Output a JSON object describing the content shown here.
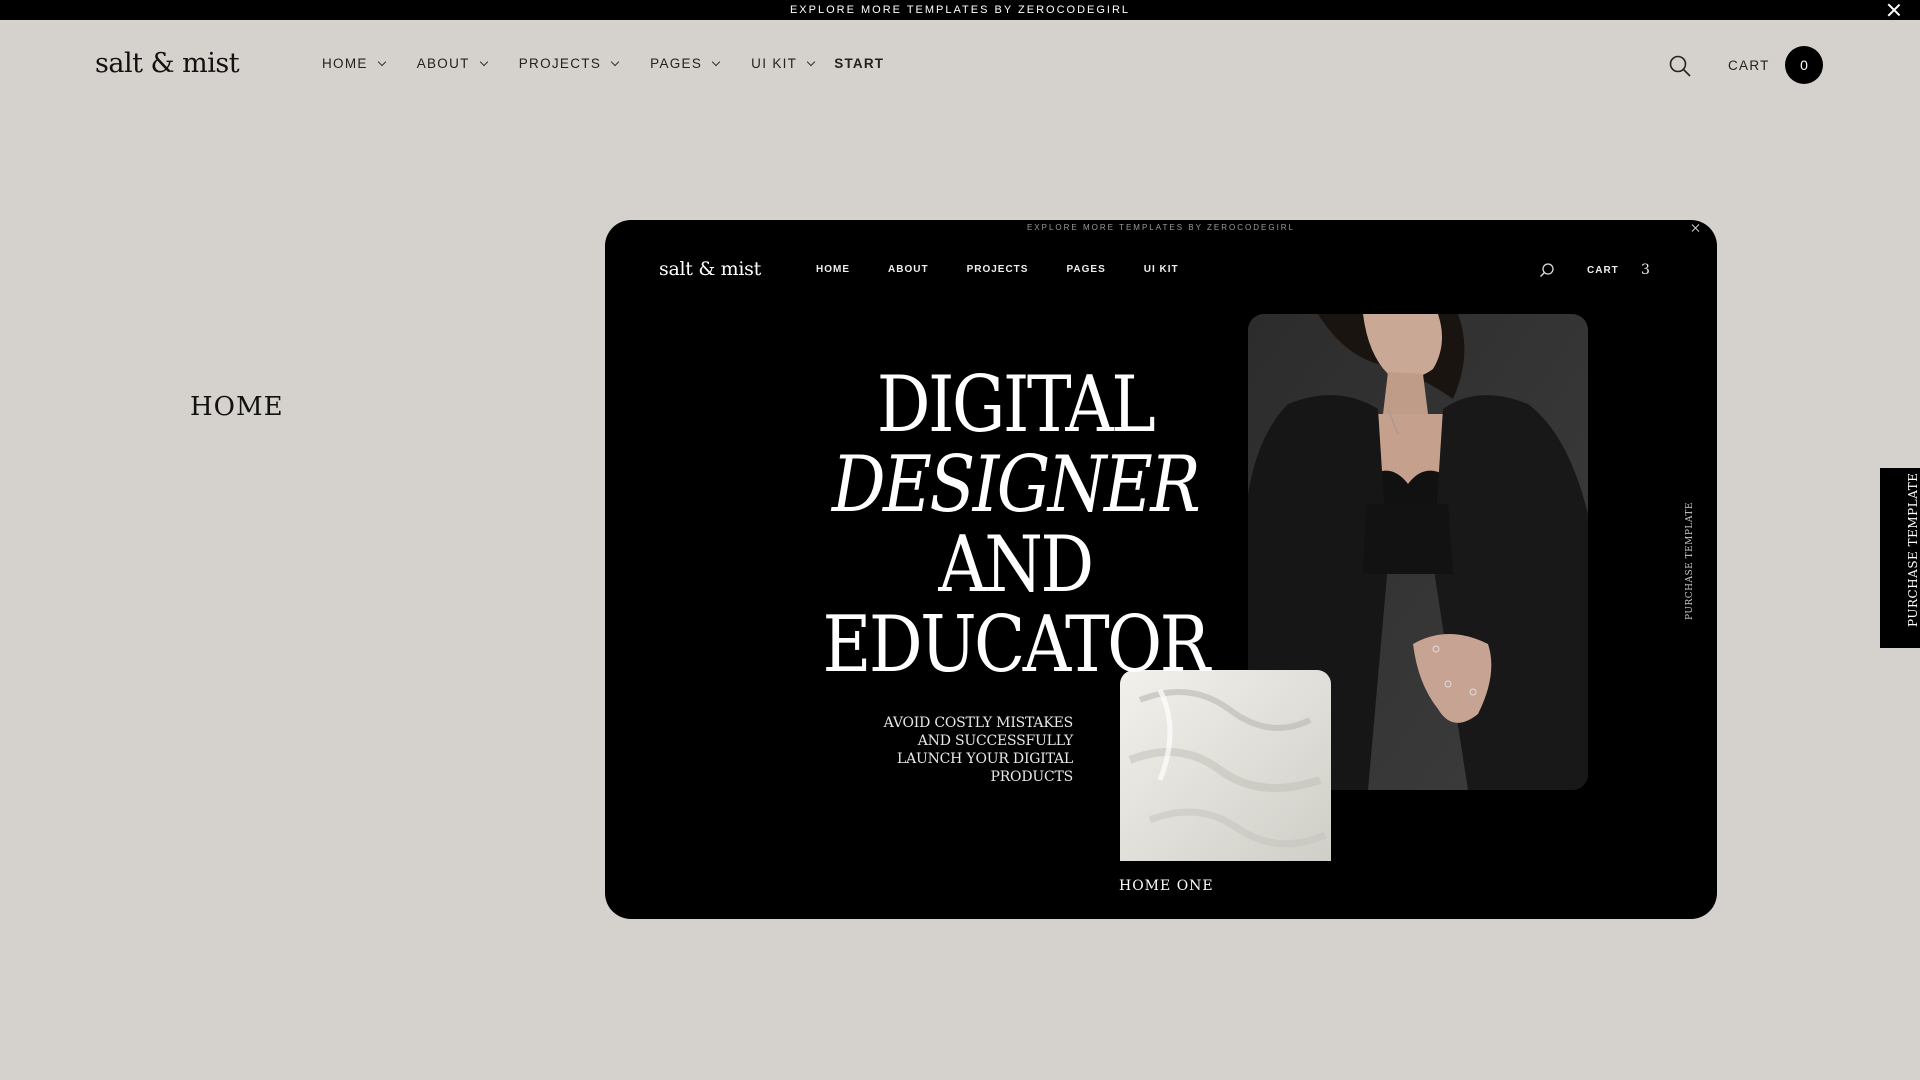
{
  "announcement": {
    "text": "EXPLORE MORE TEMPLATES BY ZEROCODEGIRL"
  },
  "header": {
    "logo": "salt & mist",
    "nav": [
      {
        "label": "HOME",
        "dropdown": true
      },
      {
        "label": "ABOUT",
        "dropdown": true
      },
      {
        "label": "PROJECTS",
        "dropdown": true
      },
      {
        "label": "PAGES",
        "dropdown": true
      },
      {
        "label": "UI KIT",
        "dropdown": true
      },
      {
        "label": "START",
        "dropdown": false
      }
    ],
    "cart_label": "CART",
    "cart_count": "0"
  },
  "section": {
    "title": "HOME"
  },
  "preview": {
    "announcement": "EXPLORE MORE TEMPLATES BY ZEROCODEGIRL",
    "logo": "salt & mist",
    "nav": [
      "HOME",
      "ABOUT",
      "PROJECTS",
      "PAGES",
      "UI KIT"
    ],
    "cart_label": "CART",
    "cart_count": "3",
    "headline": {
      "line1": "DIGITAL",
      "line2_italic": "DESIGNER",
      "line2_rest": "AND",
      "line3": "EDUCATOR"
    },
    "subtext": "AVOID COSTLY MISTAKES AND SUCCESSFULLY LAUNCH YOUR DIGITAL PRODUCTS",
    "vertical_label": "PURCHASE TEMPLATE",
    "caption": "HOME ONE"
  },
  "side_tab": {
    "label": "PURCHASE TEMPLATE"
  },
  "colors": {
    "background": "#d5d1cc",
    "dark": "#000000",
    "text": "#111111"
  },
  "icons": [
    "close-icon",
    "chevron-down-icon",
    "search-icon"
  ]
}
